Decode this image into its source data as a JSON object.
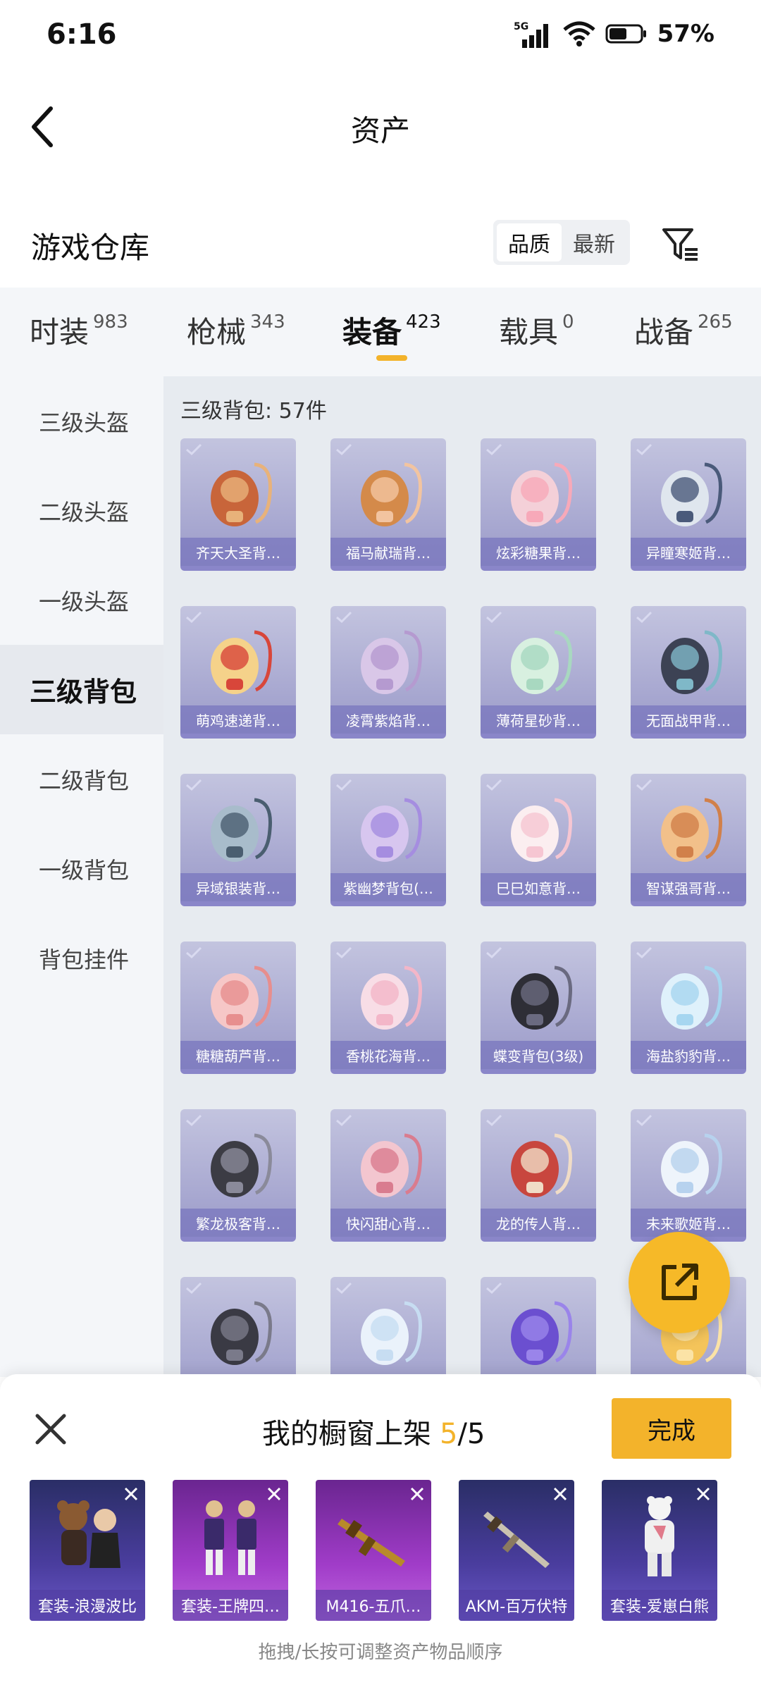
{
  "status_bar": {
    "time": "6:16",
    "network": "5G",
    "battery": "57%"
  },
  "header": {
    "title": "资产"
  },
  "section": {
    "title": "游戏仓库",
    "sort_options": [
      "品质",
      "最新"
    ],
    "active_sort": "品质"
  },
  "tabs": [
    {
      "label": "时装",
      "count": "983"
    },
    {
      "label": "枪械",
      "count": "343"
    },
    {
      "label": "装备",
      "count": "423"
    },
    {
      "label": "载具",
      "count": "0"
    },
    {
      "label": "战备",
      "count": "265"
    }
  ],
  "active_tab": "装备",
  "sidebar": {
    "items": [
      "三级头盔",
      "二级头盔",
      "一级头盔",
      "三级背包",
      "二级背包",
      "一级背包",
      "背包挂件"
    ],
    "active": "三级背包"
  },
  "content": {
    "heading": "三级背包: 57件",
    "items": [
      "齐天大圣背…",
      "福马献瑞背…",
      "炫彩糖果背…",
      "异瞳寒姬背…",
      "萌鸡速递背…",
      "凌霄紫焰背…",
      "薄荷星砂背…",
      "无面战甲背…",
      "异域银装背…",
      "紫幽梦背包(…",
      "巳巳如意背…",
      "智谋强哥背…",
      "糖糖葫芦背…",
      "香桃花海背…",
      "蝶变背包(3级)",
      "海盐豹豹背…",
      "繁龙极客背…",
      "快闪甜心背…",
      "龙的传人背…",
      "未来歌姬背…",
      "",
      "",
      "",
      ""
    ]
  },
  "sheet": {
    "title": "我的橱窗上架",
    "current": "5",
    "total": "5",
    "done_label": "完成",
    "hint": "拖拽/长按可调整资产物品顺序",
    "items": [
      {
        "name": "套装-浪漫波比"
      },
      {
        "name": "套装-王牌四…"
      },
      {
        "name": "M416-五爪…"
      },
      {
        "name": "AKM-百万伏特"
      },
      {
        "name": "套装-爱崽白熊"
      }
    ]
  }
}
